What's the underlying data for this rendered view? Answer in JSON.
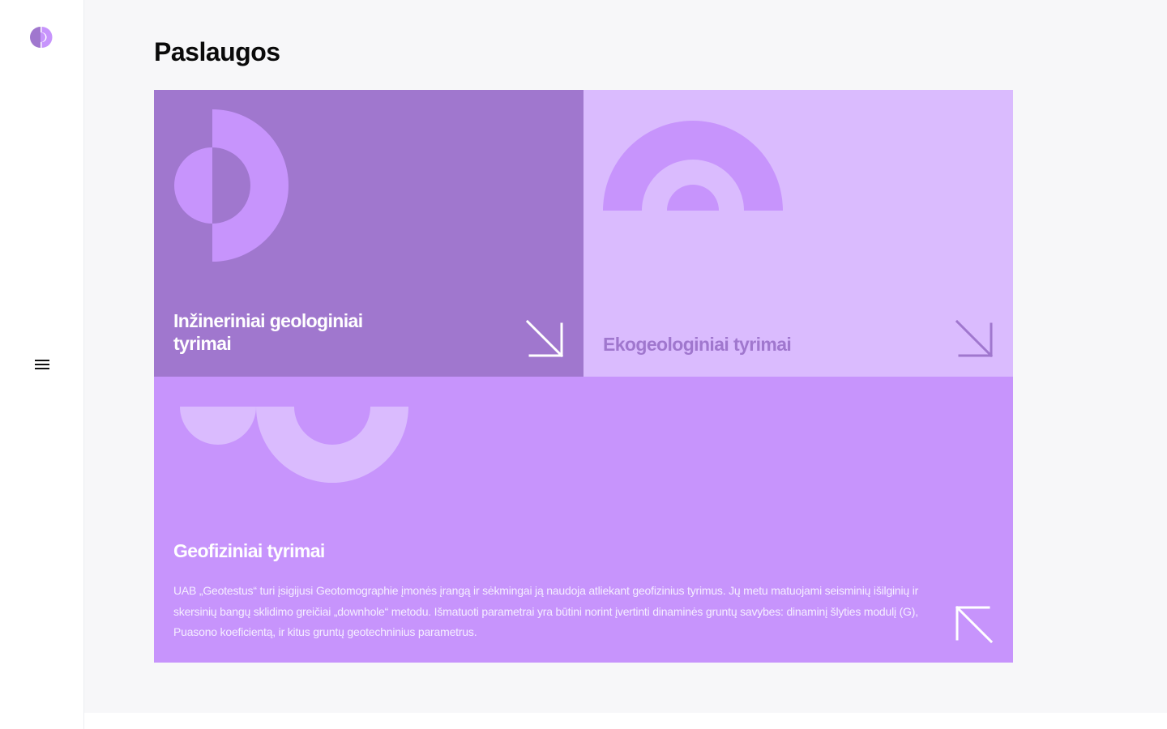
{
  "page": {
    "title": "Paslaugos"
  },
  "colors": {
    "card_dark": "#a077ce",
    "card_light": "#dabbfe",
    "card_mid": "#c794fc",
    "shape_accent": "#c794fc",
    "shape_pale": "#dabbfe",
    "title_on_light": "#a077ce"
  },
  "services": [
    {
      "title": "Inžineriniai geologiniai tyrimai",
      "arrow_icon": "arrow-down-right-icon"
    },
    {
      "title": "Ekogeologiniai tyrimai",
      "arrow_icon": "arrow-down-right-icon"
    },
    {
      "title": "Geofiziniai tyrimai",
      "description": "UAB „Geotestus“ turi įsigijusi Geotomographie įmonės įrangą ir sėkmingai ją naudoja atliekant geofizinius tyrimus. Jų metu matuojami seisminių išilginių ir skersinių bangų sklidimo greičiai „downhole“ metodu. Išmatuoti parametrai yra būtini norint įvertinti dinaminės gruntų savybes: dinaminį šlyties modulį (G), Puasono koeficientą, ir kitus gruntų geotechninius parametrus.",
      "arrow_icon": "arrow-up-left-icon"
    }
  ],
  "sidebar": {
    "logo_icon": "geotestus-logo-icon",
    "menu_icon": "hamburger-menu-icon"
  }
}
